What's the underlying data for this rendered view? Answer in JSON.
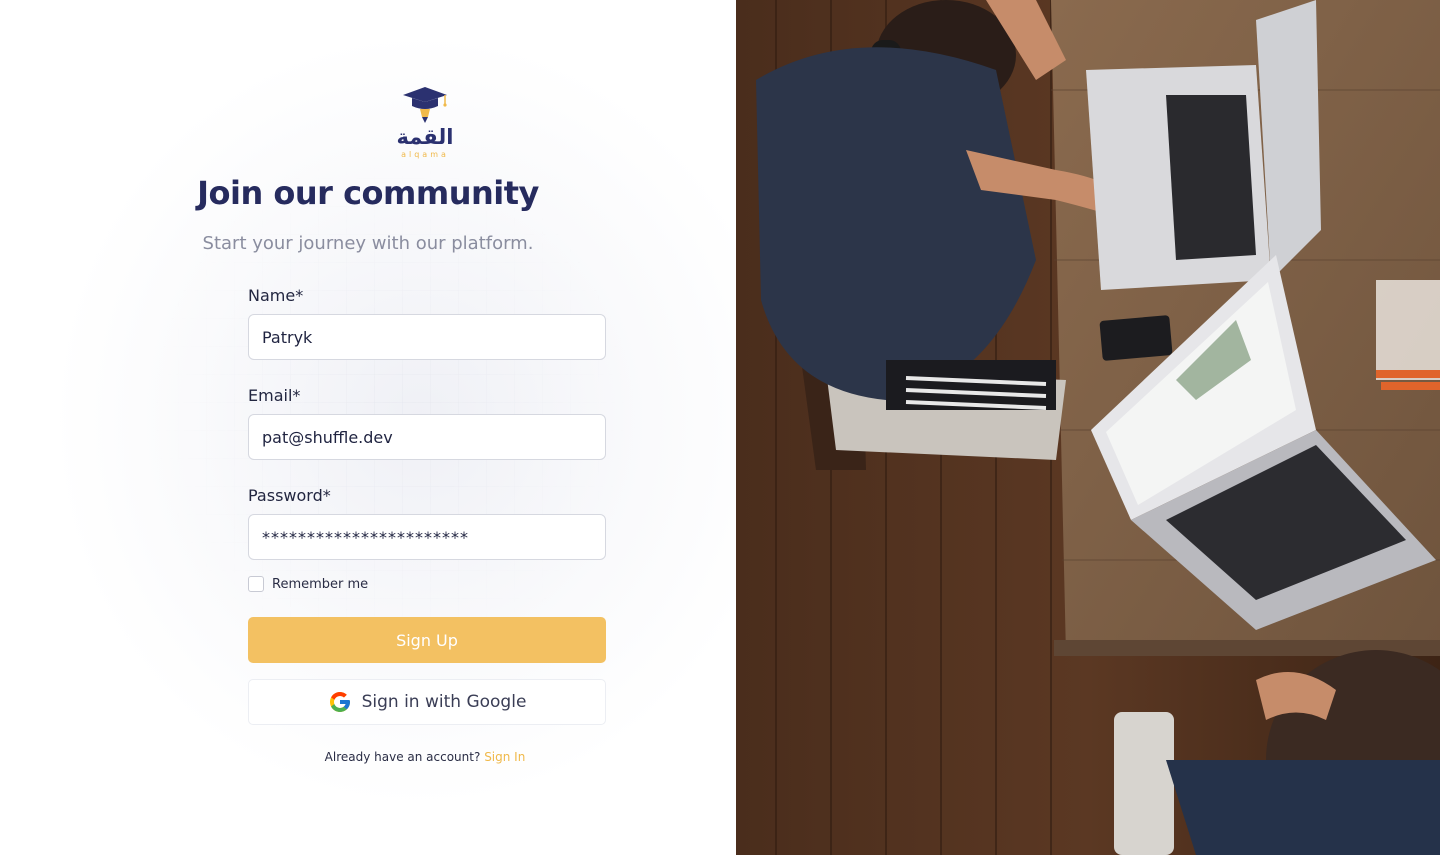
{
  "brand": {
    "logo_arabic": "القمة",
    "logo_latin": "alqama"
  },
  "heading": {
    "title": "Join our community",
    "subtitle": "Start your journey with our platform."
  },
  "form": {
    "name_label": "Name*",
    "name_value": "Patryk",
    "email_label": "Email*",
    "email_value": "pat@shuffle.dev",
    "password_label": "Password*",
    "password_value": "***********************",
    "remember_label": "Remember me",
    "remember_checked": false,
    "signup_label": "Sign Up",
    "google_label": "Sign in with Google",
    "already_text": "Already have an account?",
    "signin_link": "Sign In"
  },
  "colors": {
    "title": "#262b5e",
    "accent": "#f3c162",
    "link": "#f0b94a",
    "muted": "#8a8d9f"
  },
  "hero_image": {
    "icon": "photo-people-laptops"
  }
}
